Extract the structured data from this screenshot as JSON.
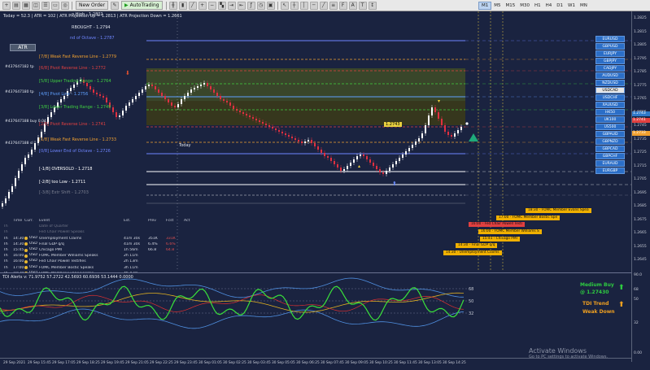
{
  "toolbar": {
    "new_order": "New Order",
    "autotrading": "AutoTrading",
    "timeframes": [
      "M1",
      "M5",
      "M15",
      "M30",
      "H1",
      "H4",
      "D1",
      "W1",
      "MN"
    ],
    "active_timeframe": "M1"
  },
  "header": {
    "line1": "Today = 52.3  |  ATR = 102  |  ATR Projection Up = 1.2813  |  ATR Projection Down = 1.2661",
    "title": "o High - 1.2802",
    "atr_button": "ATR",
    "rbought": "RBOUGHT - 1.2794"
  },
  "levels": [
    {
      "text": "nd of Octave - 1.2787",
      "color": "#6f86ff"
    },
    {
      "text": "[7/8] Weak Fast Reverse Line - 1.2779",
      "color": "#f0a030"
    },
    {
      "text": "[6/8] Pivot Reverse Line - 1.2772",
      "color": "#e04040"
    },
    {
      "text": "[5/8] Upper Trading Range - 1.2764",
      "color": "#40d040"
    },
    {
      "text": "[4/8] Pivot Line - 1.2756",
      "color": "#5fa0ff"
    },
    {
      "text": "[3/8] Lower Trading Range - 1.2749",
      "color": "#40d040"
    },
    {
      "text": "[2/8] Pivot Reverse Line - 1.2741",
      "color": "#e04040"
    },
    {
      "text": "[1/8] Weak Fast Reverse Line - 1.2733",
      "color": "#f0a030"
    },
    {
      "text": "[0/8] Lower End of Octave - 1.2726",
      "color": "#6f86ff"
    },
    {
      "text": "[-1/8] OVERSOLD - 1.2718",
      "color": "#ffffff"
    },
    {
      "text": "[-2/8] too Low - 1.2711",
      "color": "#ffffff"
    },
    {
      "text": "[-3/8] Extr Shift - 1.2703",
      "color": "#7a7f8f"
    }
  ],
  "side_labels": [
    "#437647182 tp",
    "#437647180 tp",
    "#437647188 buy 0.04",
    "#437647188 sl"
  ],
  "today_label": "Today",
  "current_price_tag": "1.2743",
  "price_axis": {
    "ticks": [
      "1.2825",
      "1.2815",
      "1.2805",
      "1.2795",
      "1.2785",
      "1.2775",
      "1.2765",
      "1.2755",
      "1.2745",
      "1.2735",
      "1.2725",
      "1.2715",
      "1.2705",
      "1.2695",
      "1.2685",
      "1.2675",
      "1.2665",
      "1.2655",
      "1.2645"
    ],
    "boxes": [
      "1.2743",
      "1.2741",
      "1.2733"
    ],
    "subwindow_ticks": [
      "90.0",
      "68",
      "50",
      "32",
      "0.00"
    ]
  },
  "symbols": [
    "EURUSD",
    "GBPUSD",
    "EURJPY",
    "GBPJPY",
    "CADJPY",
    "AUDUSD",
    "NZDUSD",
    "USDCAD",
    "USDCHF",
    "XAUUSD",
    "HK50",
    "UK100",
    "US500",
    "GBPAUD",
    "GBPNZD",
    "GBPCAD",
    "GBPCHF",
    "EURAUD",
    "EURGBP"
  ],
  "selected_symbol": "USDCAD",
  "calendar": {
    "headers": {
      "time": "Time",
      "cur": "Curr.",
      "event": "Event",
      "est": "Est.",
      "prev": "Prev",
      "fcst": "Fcst",
      "act": "Act"
    },
    "rows": [
      {
        "day": "Th",
        "time": "",
        "cur": "",
        "event": "Date of Quarter",
        "est": "",
        "prev": "",
        "fcst": "",
        "act": ""
      },
      {
        "day": "Th",
        "time": "",
        "cur": "",
        "event": "Fed Chair Powell Speaks",
        "est": "",
        "prev": "",
        "fcst": "",
        "act": ""
      },
      {
        "day": "Th",
        "time": "14:30",
        "cur": "USD",
        "event": "Unemployment Claims",
        "est": "41m 30s",
        "prev": "351K",
        "fcst": "331K",
        "act": ""
      },
      {
        "day": "Th",
        "time": "14:30",
        "cur": "USD",
        "event": "Final GDP q/q",
        "est": "41m 30s",
        "prev": "6.4%",
        "fcst": "6.6%",
        "act": ""
      },
      {
        "day": "Th",
        "time": "15:45",
        "cur": "USD",
        "event": "Chicago PMI",
        "est": "1h 56m",
        "prev": "66.8",
        "fcst": "64.8",
        "act": ""
      },
      {
        "day": "Th",
        "time": "16:00",
        "cur": "USD",
        "event": "FOMC Member Williams Speaks",
        "est": "2h 11m",
        "prev": "",
        "fcst": "",
        "act": ""
      },
      {
        "day": "Th",
        "time": "16:00",
        "cur": "USD",
        "event": "Fed Chair Powell Testifies",
        "est": "2h 13m",
        "prev": "",
        "fcst": "",
        "act": ""
      },
      {
        "day": "Th",
        "time": "17:00",
        "cur": "USD",
        "event": "FOMC Member Bostic Speaks",
        "est": "3h 11m",
        "prev": "",
        "fcst": "",
        "act": ""
      },
      {
        "day": "Th",
        "time": "18:30",
        "cur": "USD",
        "event": "FOMC Member Evans Speaks",
        "est": "4h 42m",
        "prev": "",
        "fcst": "",
        "act": ""
      },
      {
        "day": "Fr",
        "time": "02:30",
        "cur": "CAD",
        "event": "GDP m/m",
        "est": "6day 41m",
        "prev": "0.7%",
        "fcst": "-0.2%",
        "act": ""
      }
    ],
    "footer": "DRFTR News  -  Fed Chair Powell Speaks  -  Forex Factory"
  },
  "chart_events": [
    {
      "text": "18:30 - FOMC Member Evans Spea",
      "color": "#f0b000"
    },
    {
      "text": "17:00 - FOMC Member Bostic Spe",
      "color": "#f0b000"
    },
    {
      "text": "16:00 - Fed Chair Powell Testi",
      "color": "#e04040"
    },
    {
      "text": "16:00 - FOMC Member Williams S",
      "color": "#f0b000"
    },
    {
      "text": "15:45 - Chicago PMI",
      "color": "#f0b000"
    },
    {
      "text": "14:30 - Final GDP q/q",
      "color": "#f0b000"
    },
    {
      "text": "14:30 - Unemployment Claims",
      "color": "#f0b000"
    }
  ],
  "tdi": {
    "title": "TDI Alerts v: 71.9752 57.2722 42.5693 60.6936 53.1444 0.0000",
    "levels": [
      "68",
      "50",
      "32"
    ],
    "signal1": "Medium Buy",
    "signal2": "@ 1.27430",
    "trend_label": "TDI Trend",
    "trend_value": "Weak Down",
    "colors": {
      "buy": "#2ecc40",
      "trend": "#f0a020"
    }
  },
  "time_axis": [
    "29 Sep 2021",
    "29 Sep 15:45",
    "29 Sep 17:05",
    "29 Sep 18:25",
    "29 Sep 19:45",
    "29 Sep 21:05",
    "29 Sep 22:25",
    "29 Sep 23:45",
    "30 Sep 01:05",
    "30 Sep 02:25",
    "30 Sep 03:45",
    "30 Sep 05:05",
    "30 Sep 06:25",
    "30 Sep 07:45",
    "30 Sep 09:05",
    "30 Sep 10:25",
    "30 Sep 11:45",
    "30 Sep 13:05",
    "30 Sep 14:25"
  ],
  "watermark": {
    "line1": "Activate Windows",
    "line2": "Go to PC settings to activate Windows."
  }
}
